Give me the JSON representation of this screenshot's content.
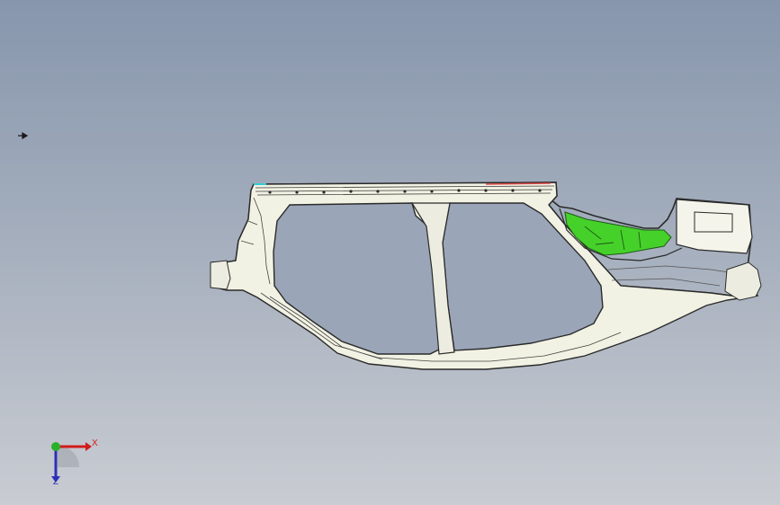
{
  "viewport": {
    "background_top": "#8796ad",
    "background_bottom": "#c9ccd2"
  },
  "model": {
    "icon": "car-body-side-frame",
    "color_body": "#f2f2e4",
    "color_edges": "#2a2a2a",
    "color_highlight": "#46d12a",
    "color_roof_marker": "#e04a4a",
    "color_cyan_marker": "#36c9d6"
  },
  "triad": {
    "x_label": "X",
    "z_label": "Z",
    "x_color": "#d21b1b",
    "y_color": "#2ab02a",
    "z_color": "#2d2fb8"
  },
  "cursor": {
    "icon": "pointer-arrow-icon"
  }
}
